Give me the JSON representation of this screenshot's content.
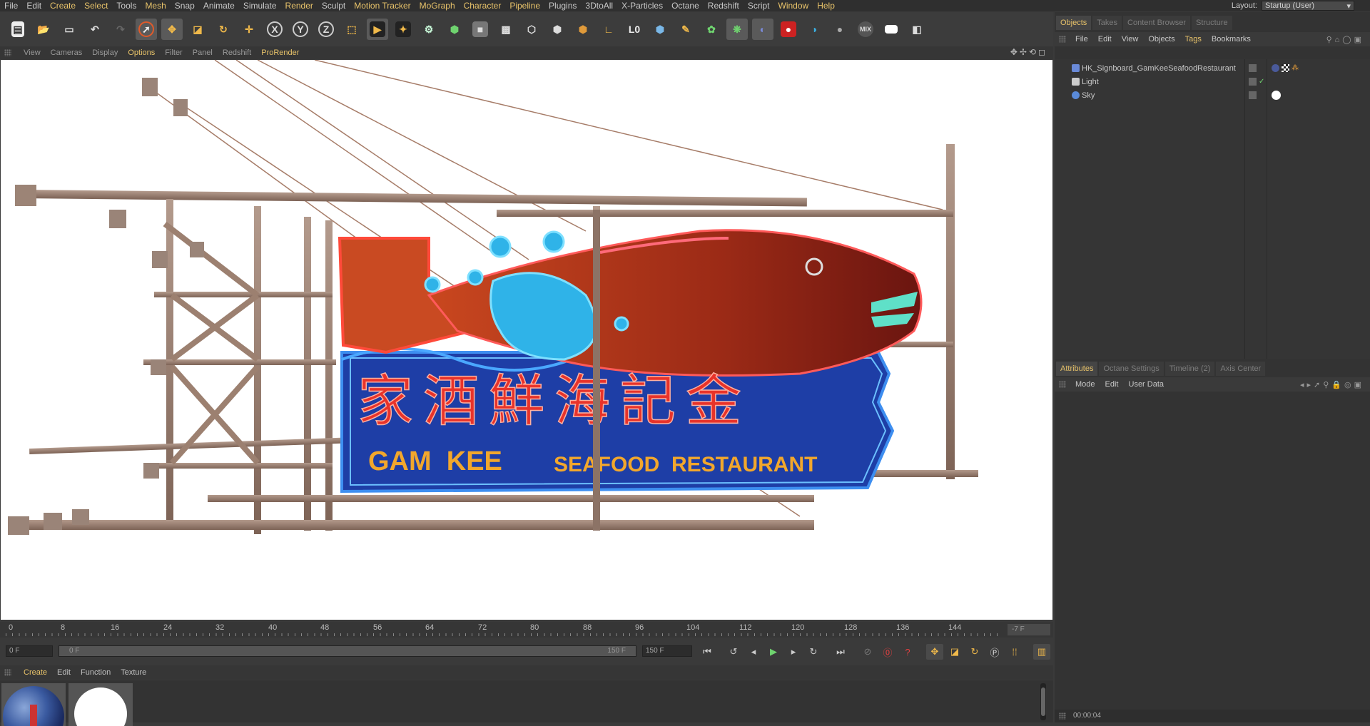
{
  "menubar": {
    "items": [
      "File",
      "Edit",
      "Create",
      "Select",
      "Tools",
      "Mesh",
      "Snap",
      "Animate",
      "Simulate",
      "Render",
      "Sculpt",
      "Motion Tracker",
      "MoGraph",
      "Character",
      "Pipeline",
      "Plugins",
      "3DtoAll",
      "X-Particles",
      "Octane",
      "Redshift",
      "Script",
      "Window",
      "Help"
    ],
    "layout_label": "Layout:",
    "layout_value": "Startup (User)"
  },
  "viewport_menu": [
    "View",
    "Cameras",
    "Display",
    "Options",
    "Filter",
    "Panel",
    "Redshift",
    "ProRender"
  ],
  "sign": {
    "chinese": "家酒鮮海記金",
    "gam_kee": "GAM  KEE",
    "seafood_restaurant": "SEAFOOD  RESTAURANT"
  },
  "timeline": {
    "ticks": [
      "0",
      "8",
      "16",
      "24",
      "32",
      "40",
      "48",
      "56",
      "64",
      "72",
      "80",
      "88",
      "96",
      "104",
      "112",
      "120",
      "128",
      "136",
      "144"
    ],
    "current": "-7 F"
  },
  "transport": {
    "start": "0 F",
    "range_start": "0 F",
    "range_end": "150 F",
    "end": "150 F"
  },
  "material_menu": [
    "Create",
    "Edit",
    "Function",
    "Texture"
  ],
  "right_tabs_top": [
    "Objects",
    "Takes",
    "Content Browser",
    "Structure"
  ],
  "objects_menu": [
    "File",
    "Edit",
    "View",
    "Objects",
    "Tags",
    "Bookmarks"
  ],
  "objects": [
    {
      "name": "HK_Signboard_GamKeeSeafoodRestaurant"
    },
    {
      "name": "Light"
    },
    {
      "name": "Sky"
    }
  ],
  "right_tabs_bottom": [
    "Attributes",
    "Octane Settings",
    "Timeline (2)",
    "Axis Center"
  ],
  "attr_menu": [
    "Mode",
    "Edit",
    "User Data"
  ],
  "status_time": "00:00:04",
  "colors": {
    "accent": "#e8c36a",
    "sign_blue": "#1f3fa8",
    "neon_red": "#e8332a",
    "gold": "#f2a72c"
  }
}
